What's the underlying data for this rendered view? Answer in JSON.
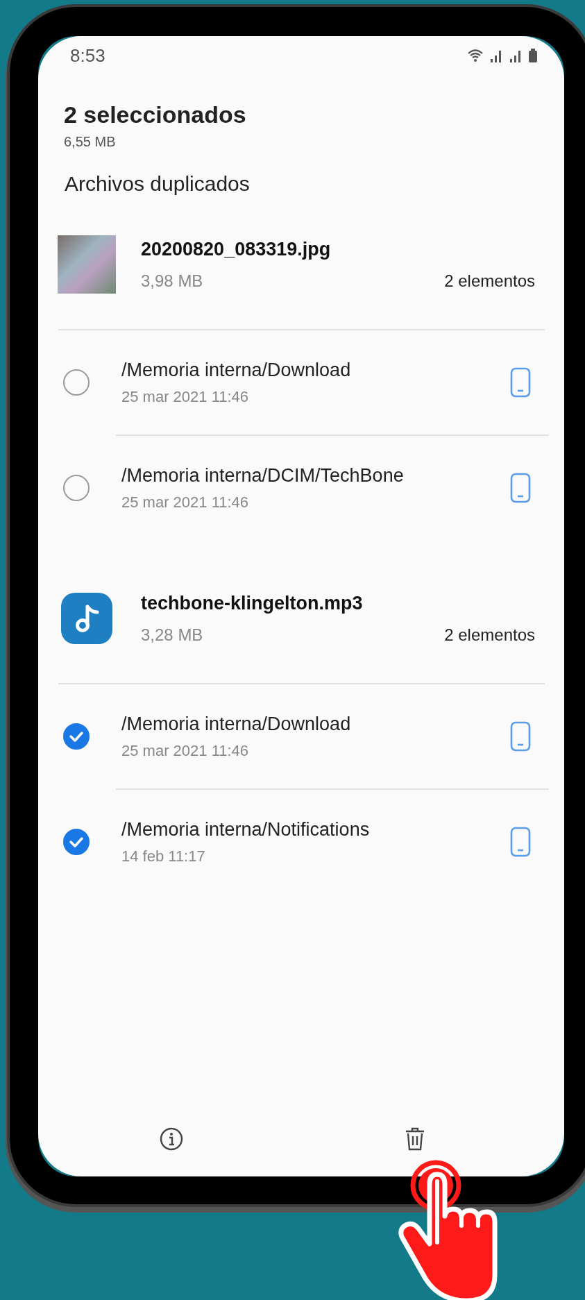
{
  "status_bar": {
    "time": "8:53"
  },
  "header": {
    "title": "2 seleccionados",
    "size": "6,55 MB"
  },
  "section_title": "Archivos duplicados",
  "groups": [
    {
      "kind": "image",
      "name": "20200820_083319.jpg",
      "size": "3,98 MB",
      "count": "2 elementos",
      "items": [
        {
          "path": "/Memoria interna/Download",
          "date": "25 mar 2021 11:46",
          "selected": false
        },
        {
          "path": "/Memoria interna/DCIM/TechBone",
          "date": "25 mar 2021 11:46",
          "selected": false
        }
      ]
    },
    {
      "kind": "audio",
      "name": "techbone-klingelton.mp3",
      "size": "3,28 MB",
      "count": "2 elementos",
      "items": [
        {
          "path": "/Memoria interna/Download",
          "date": "25 mar 2021 11:46",
          "selected": true
        },
        {
          "path": "/Memoria interna/Notifications",
          "date": "14 feb 11:17",
          "selected": true
        }
      ]
    }
  ]
}
